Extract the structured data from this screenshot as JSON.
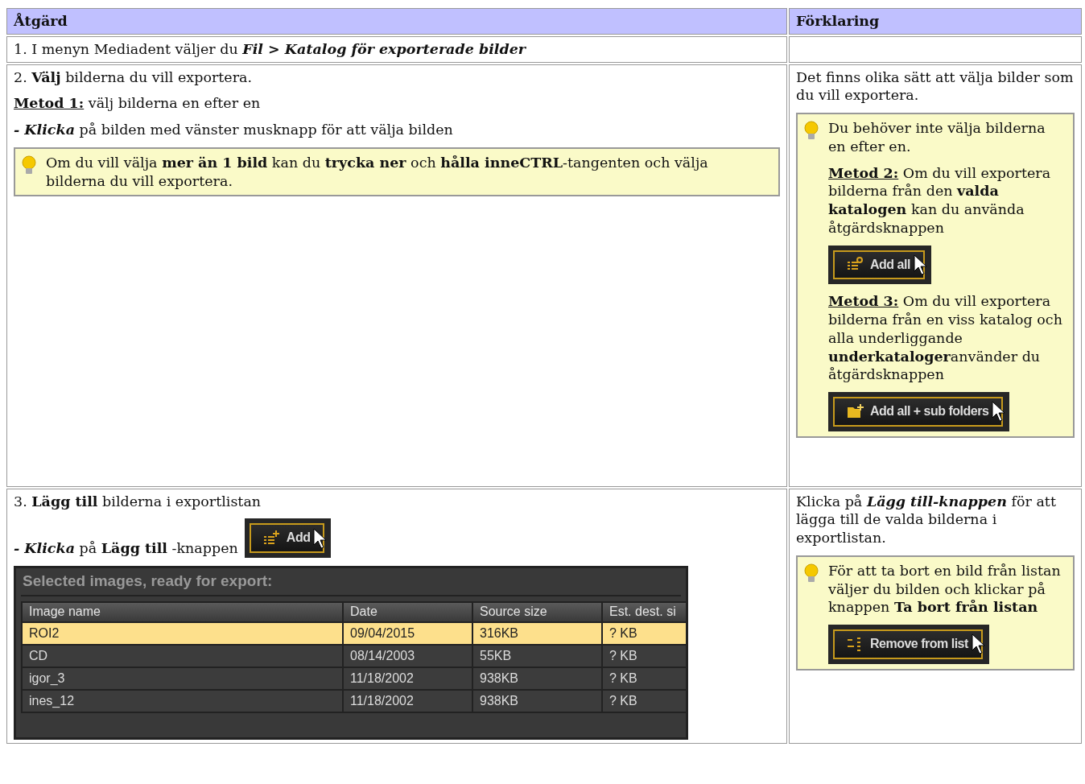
{
  "table": {
    "columns": [
      "Åtgärd",
      "Förklaring"
    ],
    "rows": [
      {
        "action": [
          {
            "kind": "para",
            "text": "1. I menyn Mediadent väljer du *Fil > Katalog för exporterade bilder*"
          }
        ],
        "explanation": []
      },
      {
        "action": [
          {
            "kind": "para",
            "text": "2. **Välj** bilderna du vill exportera."
          },
          {
            "kind": "method",
            "label": "Metod 1:",
            "text": "välj bilderna en efter en"
          },
          {
            "kind": "para",
            "text": "*- Klicka* på bilden med vänster musknapp för att välja bilden"
          },
          {
            "kind": "tip",
            "blocks": [
              {
                "kind": "para",
                "text": "Om du vill välja **mer än 1 bild** kan du **trycka ner** och **hålla inneCTRL**-tangenten och välja bilderna du vill exportera."
              }
            ]
          }
        ],
        "explanation": [
          {
            "kind": "para",
            "text": "Det finns olika sätt att välja bilder som du vill exportera."
          },
          {
            "kind": "tip",
            "blocks": [
              {
                "kind": "para",
                "text": "Du behöver inte välja bilderna en efter en."
              },
              {
                "kind": "method",
                "label": "Metod 2:",
                "text": "Om du vill exportera bilderna från den **valda katalogen** kan du använda åtgärdsknappen"
              },
              {
                "kind": "button",
                "label": "Add all"
              },
              {
                "kind": "method",
                "label": "Metod 3:",
                "text": "Om du vill exportera bilderna från en viss katalog och alla underliggande **underkataloger**använder du åtgärdsknappen"
              },
              {
                "kind": "button",
                "label": "Add all + sub folders"
              }
            ]
          }
        ]
      },
      {
        "action": [
          {
            "kind": "para",
            "text": "3. **Lägg till** bilderna i exportlistan"
          },
          {
            "kind": "para_button",
            "text": "*- Klicka* på **Lägg till** -knappen",
            "button": {
              "label": "Add"
            }
          },
          {
            "kind": "export_table",
            "title": "Selected images, ready for export:",
            "columns": [
              "Image name",
              "Date",
              "Source size",
              "Est. dest. si"
            ],
            "rows": [
              {
                "cells": [
                  "ROI2",
                  "09/04/2015",
                  "316KB",
                  "? KB"
                ],
                "selected": true
              },
              {
                "cells": [
                  "CD",
                  "08/14/2003",
                  "55KB",
                  "? KB"
                ],
                "selected": false
              },
              {
                "cells": [
                  "igor_3",
                  "11/18/2002",
                  "938KB",
                  "? KB"
                ],
                "selected": false
              },
              {
                "cells": [
                  "ines_12",
                  "11/18/2002",
                  "938KB",
                  "? KB"
                ],
                "selected": false
              }
            ]
          }
        ],
        "explanation": [
          {
            "kind": "para",
            "text": "Klicka på *Lägg till-knappen* för att lägga till de valda bilderna i exportlistan."
          },
          {
            "kind": "tip",
            "blocks": [
              {
                "kind": "para",
                "text": "För att ta bort en bild från listan väljer du bilden och klickar på knappen **Ta bort från listan**"
              },
              {
                "kind": "button",
                "label": "Remove from list"
              }
            ]
          }
        ]
      }
    ]
  }
}
